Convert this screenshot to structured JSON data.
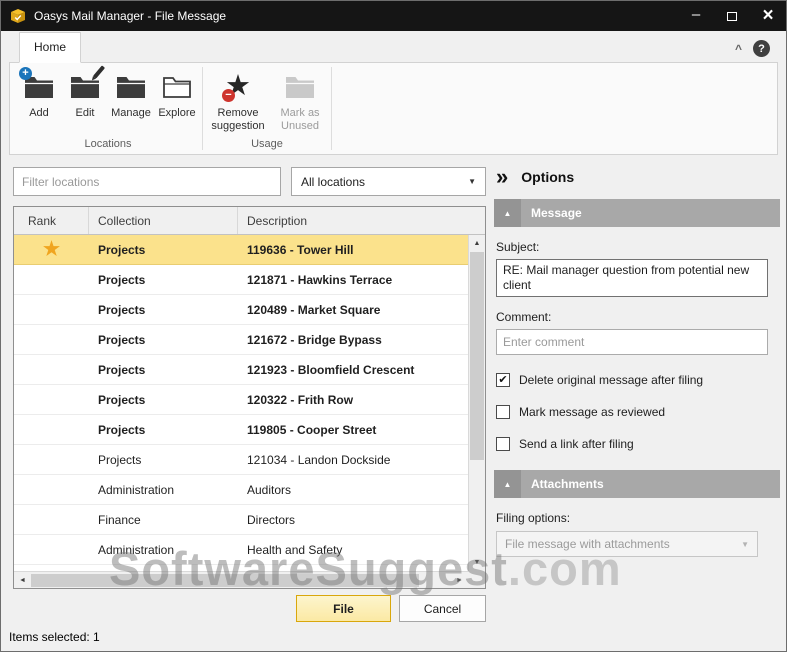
{
  "window": {
    "title": "Oasys Mail Manager - File Message"
  },
  "icons": {
    "minimize": "–",
    "close": "×",
    "help": "?",
    "collapse_ribbon": "^",
    "star": "★",
    "plus": "+",
    "minus": "−",
    "dropdown_arrow": "▼",
    "section_collapse": "▲",
    "options_chevrons": "»",
    "check": "✔",
    "scroll_up": "▲",
    "scroll_down": "▼",
    "scroll_left": "◄",
    "scroll_right": "►"
  },
  "ribbon": {
    "home_tab": "Home",
    "groups": [
      {
        "label": "Locations",
        "buttons": [
          {
            "label": "Add"
          },
          {
            "label": "Edit"
          },
          {
            "label": "Manage"
          },
          {
            "label": "Explore"
          }
        ]
      },
      {
        "label": "Usage",
        "buttons": [
          {
            "label": "Remove suggestion"
          },
          {
            "label": "Mark as Unused"
          }
        ]
      }
    ]
  },
  "filter": {
    "placeholder": "Filter locations",
    "scope_dropdown": "All locations"
  },
  "table": {
    "columns": [
      "Rank",
      "Collection",
      "Description"
    ],
    "rows": [
      {
        "starred": true,
        "collection": "Projects",
        "description": "119636 - Tower Hill",
        "bold": true,
        "selected": true
      },
      {
        "starred": false,
        "collection": "Projects",
        "description": "121871 - Hawkins Terrace",
        "bold": true,
        "selected": false
      },
      {
        "starred": false,
        "collection": "Projects",
        "description": "120489 - Market Square",
        "bold": true,
        "selected": false
      },
      {
        "starred": false,
        "collection": "Projects",
        "description": "121672 - Bridge Bypass",
        "bold": true,
        "selected": false
      },
      {
        "starred": false,
        "collection": "Projects",
        "description": "121923 - Bloomfield Crescent",
        "bold": true,
        "selected": false
      },
      {
        "starred": false,
        "collection": "Projects",
        "description": "120322 - Frith Row",
        "bold": true,
        "selected": false
      },
      {
        "starred": false,
        "collection": "Projects",
        "description": "119805 - Cooper Street",
        "bold": true,
        "selected": false
      },
      {
        "starred": false,
        "collection": "Projects",
        "description": "121034 - Landon Dockside",
        "bold": false,
        "selected": false
      },
      {
        "starred": false,
        "collection": "Administration",
        "description": "Auditors",
        "bold": false,
        "selected": false
      },
      {
        "starred": false,
        "collection": "Finance",
        "description": "Directors",
        "bold": false,
        "selected": false
      },
      {
        "starred": false,
        "collection": "Administration",
        "description": "Health and Safety",
        "bold": false,
        "selected": false
      }
    ]
  },
  "actions": {
    "file": "File",
    "cancel": "Cancel"
  },
  "status_bar": {
    "items_selected": "Items selected: 1"
  },
  "options_panel": {
    "title": "Options",
    "message": {
      "header": "Message",
      "subject_label": "Subject:",
      "subject_value": "RE: Mail manager question from potential new client",
      "comment_label": "Comment:",
      "comment_placeholder": "Enter comment",
      "checkboxes": [
        {
          "label": "Delete original message after filing",
          "checked": true
        },
        {
          "label": "Mark message as reviewed",
          "checked": false
        },
        {
          "label": "Send a link after filing",
          "checked": false
        }
      ]
    },
    "attachments": {
      "header": "Attachments",
      "filing_options_label": "Filing options:",
      "filing_options_value": "File message with attachments"
    }
  },
  "watermark": {
    "text": "SoftwareSuggest",
    "suffix": ".com"
  }
}
